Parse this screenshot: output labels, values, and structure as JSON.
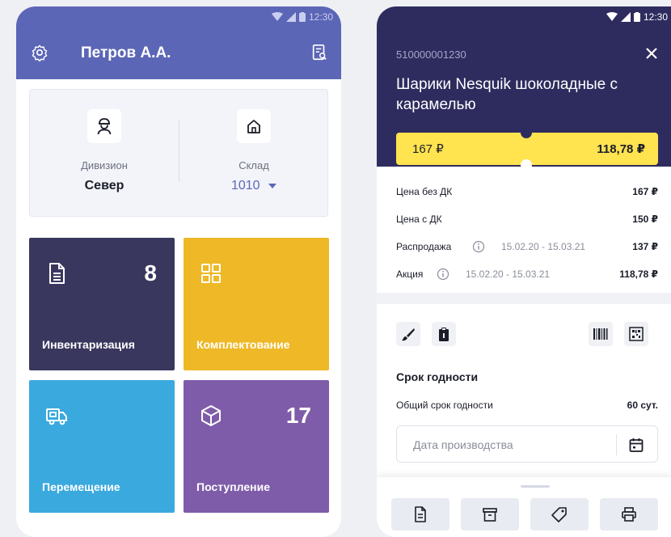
{
  "left_phone": {
    "status_time": "12:30",
    "header": {
      "user_name": "Петров А.А.",
      "settings_icon": "gear-icon",
      "doc_icon": "document-search-icon"
    },
    "info_card": {
      "division": {
        "label": "Дивизион",
        "value": "Север",
        "icon": "engineer-icon"
      },
      "warehouse": {
        "label": "Склад",
        "value": "1010",
        "icon": "home-icon"
      }
    },
    "tiles": [
      {
        "label": "Инвентаризация",
        "count": "8",
        "icon": "document-icon",
        "color": "#3a375e"
      },
      {
        "label": "Комплектование",
        "count": "",
        "icon": "grid-icon",
        "color": "#eeb826"
      },
      {
        "label": "Перемещение",
        "count": "",
        "icon": "truck-icon",
        "color": "#39a9de"
      },
      {
        "label": "Поступление",
        "count": "17",
        "icon": "box-icon",
        "color": "#7e5ca9"
      }
    ]
  },
  "right_phone": {
    "status_time": "12:30",
    "product": {
      "code": "510000001230",
      "title": "Шарики Nesquik шоколадные с карамелью"
    },
    "ticket": {
      "old_price": "167 ₽",
      "new_price": "118,78 ₽"
    },
    "price_rows": [
      {
        "label": "Цена без ДК",
        "dates": "",
        "price": "167 ₽",
        "info": false
      },
      {
        "label": "Цена с ДК",
        "dates": "",
        "price": "150 ₽",
        "info": false
      },
      {
        "label": "Распродажа",
        "dates": "15.02.20 - 15.03.21",
        "price": "137 ₽",
        "info": true
      },
      {
        "label": "Акция",
        "dates": "15.02.20 - 15.03.21",
        "price": "118,78 ₽",
        "info": true
      }
    ],
    "tools": [
      "brush-icon",
      "clipboard-icon",
      "barcode-icon",
      "qr-code-icon"
    ],
    "shelf_life": {
      "section_title": "Срок годности",
      "label": "Общий срок годности",
      "value": "60 сут.",
      "production_placeholder": "Дата производства"
    },
    "bottom_buttons": [
      "document-icon",
      "archive-icon",
      "tag-icon",
      "printer-icon"
    ]
  }
}
